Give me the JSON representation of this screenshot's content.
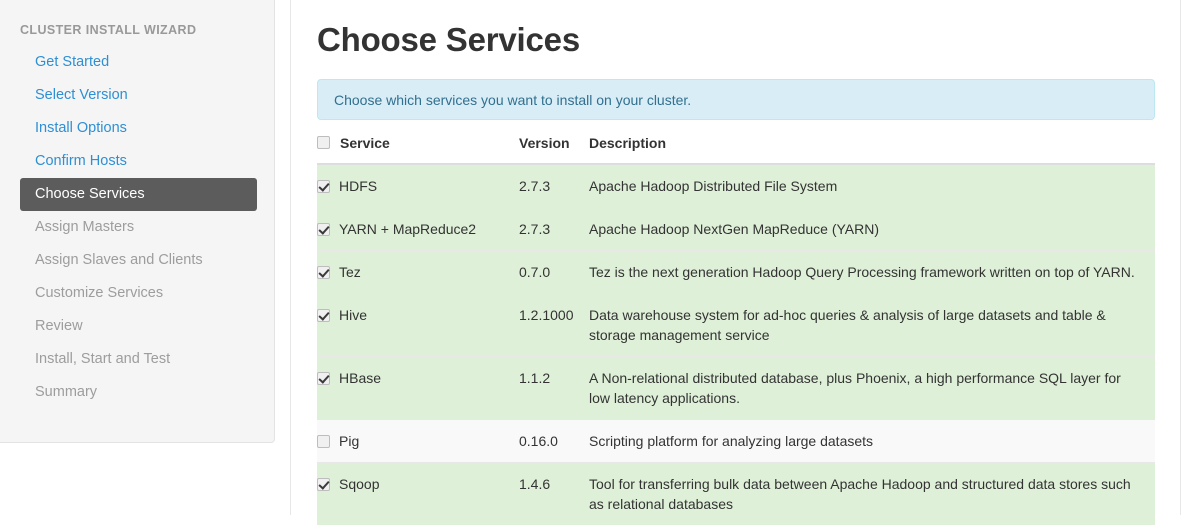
{
  "sidebar": {
    "title": "CLUSTER INSTALL WIZARD",
    "items": [
      {
        "label": "Get Started",
        "state": "link"
      },
      {
        "label": "Select Version",
        "state": "link"
      },
      {
        "label": "Install Options",
        "state": "link"
      },
      {
        "label": "Confirm Hosts",
        "state": "link"
      },
      {
        "label": "Choose Services",
        "state": "active"
      },
      {
        "label": "Assign Masters",
        "state": "disabled"
      },
      {
        "label": "Assign Slaves and Clients",
        "state": "disabled"
      },
      {
        "label": "Customize Services",
        "state": "disabled"
      },
      {
        "label": "Review",
        "state": "disabled"
      },
      {
        "label": "Install, Start and Test",
        "state": "disabled"
      },
      {
        "label": "Summary",
        "state": "disabled"
      }
    ]
  },
  "main": {
    "page_title": "Choose Services",
    "info_message": "Choose which services you want to install on your cluster."
  },
  "table": {
    "headers": {
      "select_all_checked": false,
      "service": "Service",
      "version": "Version",
      "description": "Description"
    },
    "rows": [
      {
        "checked": true,
        "service": "HDFS",
        "version": "2.7.3",
        "description": "Apache Hadoop Distributed File System"
      },
      {
        "checked": true,
        "service": "YARN + MapReduce2",
        "version": "2.7.3",
        "description": "Apache Hadoop NextGen MapReduce (YARN)"
      },
      {
        "checked": true,
        "service": "Tez",
        "version": "0.7.0",
        "description": "Tez is the next generation Hadoop Query Processing framework written on top of YARN."
      },
      {
        "checked": true,
        "service": "Hive",
        "version": "1.2.1000",
        "description": "Data warehouse system for ad-hoc queries & analysis of large datasets and table & storage management service"
      },
      {
        "checked": true,
        "service": "HBase",
        "version": "1.1.2",
        "description": "A Non-relational distributed database, plus Phoenix, a high performance SQL layer for low latency applications."
      },
      {
        "checked": false,
        "service": "Pig",
        "version": "0.16.0",
        "description": "Scripting platform for analyzing large datasets"
      },
      {
        "checked": true,
        "service": "Sqoop",
        "version": "1.4.6",
        "description": "Tool for transferring bulk data between Apache Hadoop and structured data stores such as relational databases"
      }
    ]
  },
  "colors": {
    "accent_link": "#2f8fd3",
    "active_nav_bg": "#5c5c5c",
    "info_bg": "#d9edf7",
    "info_border": "#bce8f1",
    "info_text": "#31708f",
    "row_selected_bg": "#dff0d8",
    "row_stripe_bg": "#f9f9f9",
    "sidebar_bg": "#f5f5f5"
  }
}
